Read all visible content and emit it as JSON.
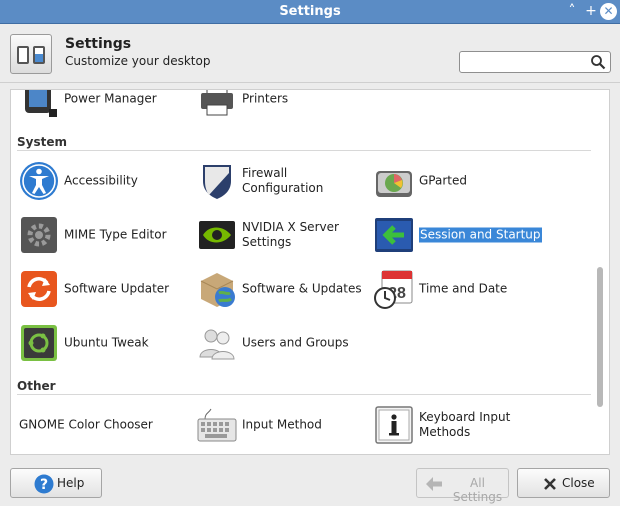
{
  "window": {
    "title": "Settings"
  },
  "header": {
    "title": "Settings",
    "subtitle": "Customize your desktop"
  },
  "search": {
    "value": "",
    "placeholder": ""
  },
  "partial_row": [
    {
      "label": "Power Manager",
      "icon": "power-manager-icon"
    },
    {
      "label": "Printers",
      "icon": "printer-icon"
    }
  ],
  "sections": [
    {
      "title": "System",
      "items": [
        {
          "label": "Accessibility",
          "icon": "accessibility-icon"
        },
        {
          "label": "Firewall Configuration",
          "icon": "firewall-icon"
        },
        {
          "label": "GParted",
          "icon": "gparted-icon"
        },
        {
          "label": "MIME Type Editor",
          "icon": "mime-editor-icon"
        },
        {
          "label": "NVIDIA X Server Settings",
          "icon": "nvidia-icon"
        },
        {
          "label": "Session and Startup",
          "icon": "session-startup-icon",
          "selected": true
        },
        {
          "label": "Software Updater",
          "icon": "software-updater-icon"
        },
        {
          "label": "Software & Updates",
          "icon": "software-updates-icon"
        },
        {
          "label": "Time and Date",
          "icon": "time-date-icon"
        },
        {
          "label": "Ubuntu Tweak",
          "icon": "ubuntu-tweak-icon"
        },
        {
          "label": "Users and Groups",
          "icon": "users-groups-icon"
        }
      ]
    },
    {
      "title": "Other",
      "items": [
        {
          "label": "GNOME Color Chooser",
          "icon": ""
        },
        {
          "label": "Input Method",
          "icon": "keyboard-icon"
        },
        {
          "label": "Keyboard Input Methods",
          "icon": "info-icon"
        }
      ]
    }
  ],
  "footer": {
    "help": "Help",
    "all_settings": "All Settings",
    "close": "Close"
  },
  "colors": {
    "titlebar": "#5b8cc5",
    "selection": "#3a87d8",
    "help_icon": "#2e7bd0"
  }
}
